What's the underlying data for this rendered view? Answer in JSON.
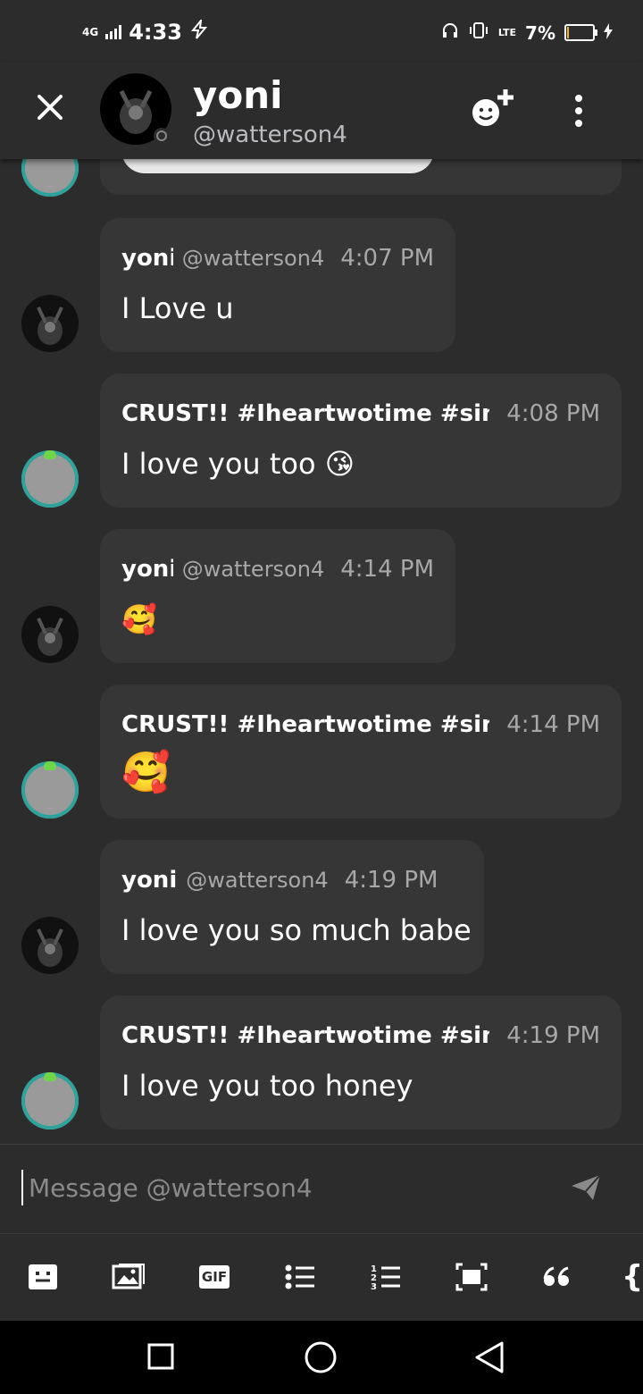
{
  "status_bar": {
    "time": "4:33",
    "network": "4G",
    "lte": "LTE",
    "battery": "7%",
    "battery_level": 0.07
  },
  "header": {
    "name": "yoni",
    "handle": "@watterson4"
  },
  "messages": [
    {
      "user": "yoni",
      "handle": "@watterson4",
      "time": "4:07 PM",
      "text": "I Love u",
      "avatar": "dark"
    },
    {
      "user": "CRUST!! #Iheartwotime #sin",
      "handle": "",
      "time": "4:08 PM",
      "text": "I love you too 😘",
      "avatar": "green"
    },
    {
      "user": "yoni",
      "handle": "@watterson4",
      "time": "4:14 PM",
      "text": "🥰",
      "avatar": "dark"
    },
    {
      "user": "CRUST!! #Iheartwotime #sin",
      "handle": "",
      "time": "4:14 PM",
      "text": "🥰",
      "avatar": "green"
    },
    {
      "user": "yoni",
      "handle": "@watterson4",
      "time": "4:19 PM",
      "text": "I love you so much babe",
      "avatar": "dark"
    },
    {
      "user": "CRUST!! #Iheartwotime #sin",
      "handle": "",
      "time": "4:19 PM",
      "text": "I love you too honey",
      "avatar": "green"
    }
  ],
  "composer": {
    "placeholder": "Message @watterson4",
    "value": ""
  },
  "toolbar": {
    "items": [
      "emoji-icon",
      "image-icon",
      "gif-icon",
      "bullet-list-icon",
      "numbered-list-icon",
      "spoiler-icon",
      "quote-icon",
      "code-icon"
    ],
    "gif_label": "GIF",
    "code_label": "{"
  }
}
